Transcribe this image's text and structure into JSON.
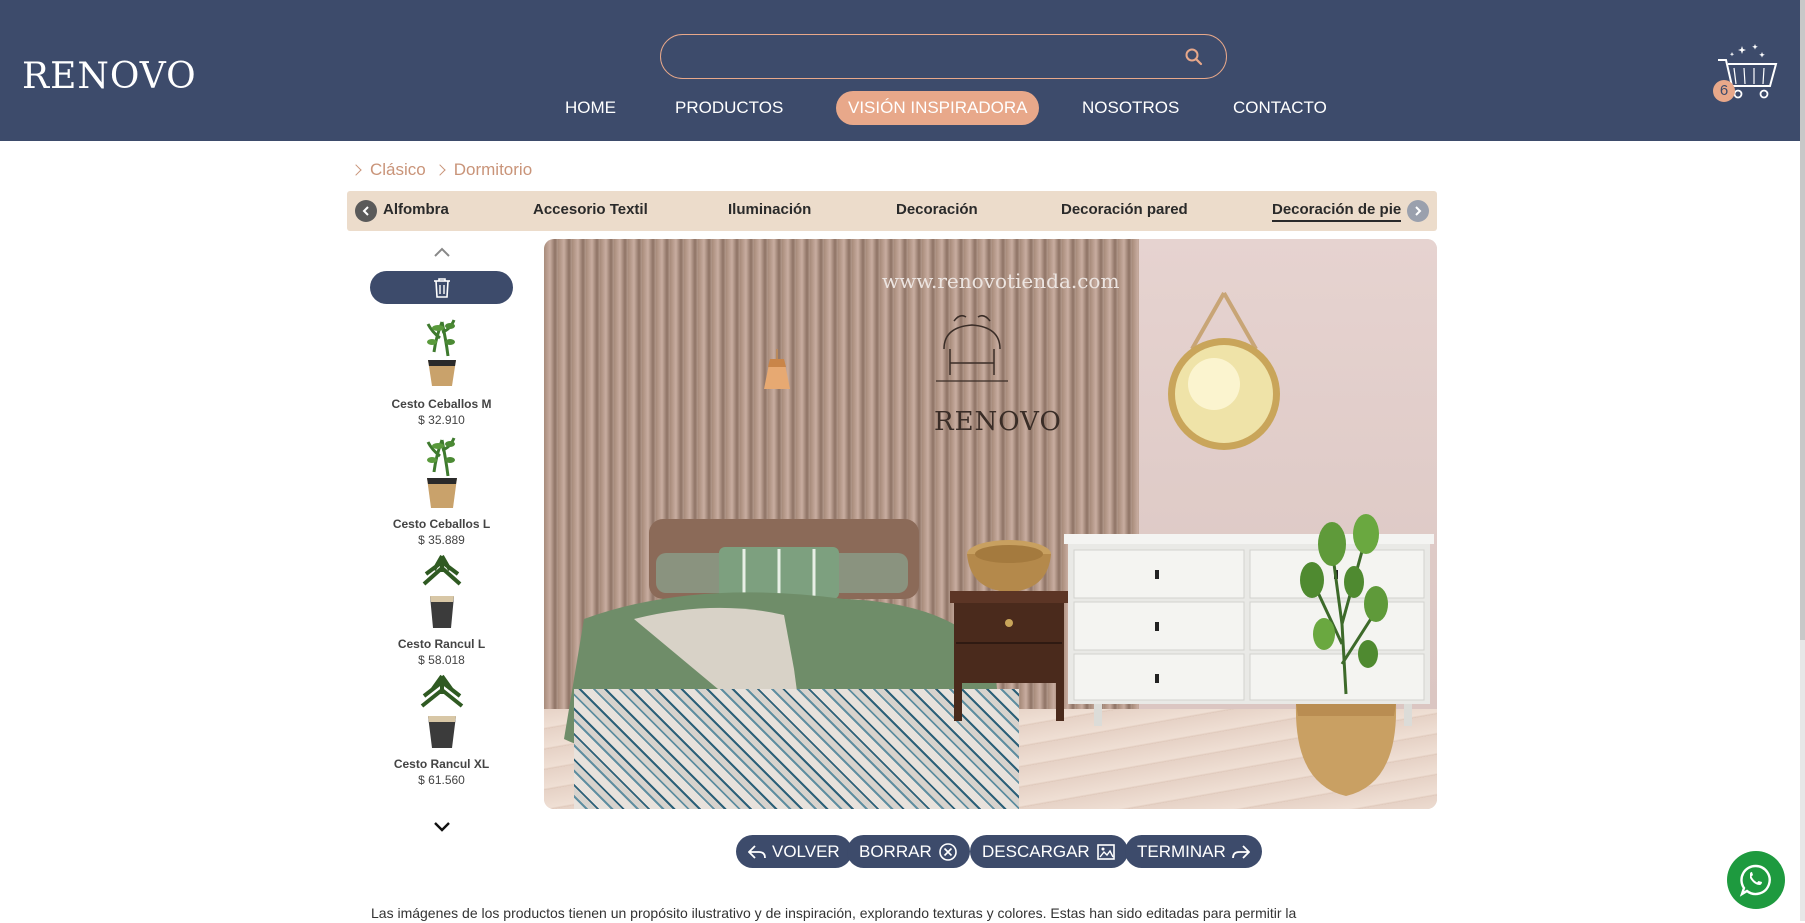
{
  "brand": {
    "logo_text": "RENOVO"
  },
  "search": {
    "placeholder": "",
    "value": "",
    "icon": "search-icon"
  },
  "nav": {
    "items": [
      {
        "label": "HOME"
      },
      {
        "label": "PRODUCTOS"
      },
      {
        "label": "VISIÓN INSPIRADORA"
      },
      {
        "label": "NOSOTROS"
      },
      {
        "label": "CONTACTO"
      }
    ],
    "active_index": 2
  },
  "cart": {
    "count": "6",
    "icon": "shopping-cart-icon"
  },
  "breadcrumb": {
    "items": [
      {
        "label": "Clásico"
      },
      {
        "label": "Dormitorio"
      }
    ]
  },
  "categories": {
    "items": [
      {
        "label": "Alfombra"
      },
      {
        "label": "Accesorio Textil"
      },
      {
        "label": "Iluminación"
      },
      {
        "label": "Decoración"
      },
      {
        "label": "Decoración pared"
      },
      {
        "label": "Decoración de pie"
      }
    ],
    "active_index": 5
  },
  "products": [
    {
      "name": "Cesto Ceballos M",
      "price": "$ 32.910"
    },
    {
      "name": "Cesto Ceballos L",
      "price": "$ 35.889"
    },
    {
      "name": "Cesto Rancul L",
      "price": "$ 58.018"
    },
    {
      "name": "Cesto Rancul XL",
      "price": "$ 61.560"
    }
  ],
  "scene": {
    "watermark_url": "www.renovotienda.com",
    "watermark_brand": "RENOVO"
  },
  "actions": {
    "back_label": "VOLVER",
    "clear_label": "BORRAR",
    "download_label": "DESCARGAR",
    "finish_label": "TERMINAR"
  },
  "disclaimer": "Las imágenes de los productos tienen un propósito ilustrativo y de inspiración, explorando texturas y colores. Estas han sido editadas para permitir la",
  "colors": {
    "header_bg": "#3d4b6b",
    "accent": "#e8a88a",
    "category_bar": "#ecdccb",
    "whatsapp": "#1e9a3f"
  }
}
